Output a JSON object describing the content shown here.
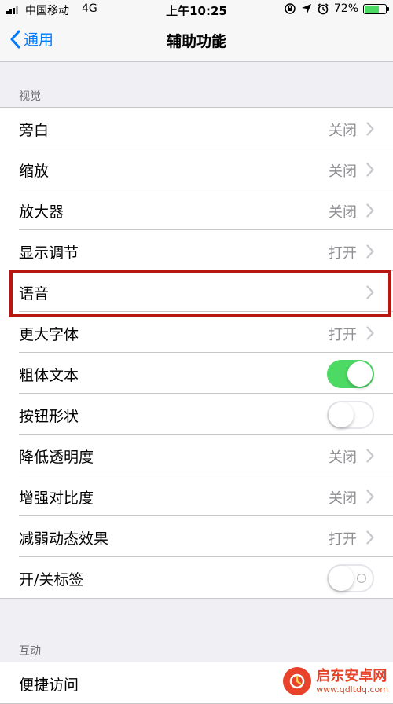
{
  "status_bar": {
    "carrier": "中国移动",
    "network": "4G",
    "time": "上午10:25",
    "battery": "72%",
    "battery_level": 0.72
  },
  "nav": {
    "back_label": "通用",
    "title": "辅助功能"
  },
  "sections": {
    "vision_header": "视觉",
    "interaction_header": "互动"
  },
  "vision_items": [
    {
      "label": "旁白",
      "value": "关闭",
      "control": "chevron"
    },
    {
      "label": "缩放",
      "value": "关闭",
      "control": "chevron"
    },
    {
      "label": "放大器",
      "value": "关闭",
      "control": "chevron"
    },
    {
      "label": "显示调节",
      "value": "打开",
      "control": "chevron"
    },
    {
      "label": "语音",
      "value": "",
      "control": "chevron"
    },
    {
      "label": "更大字体",
      "value": "打开",
      "control": "chevron"
    },
    {
      "label": "粗体文本",
      "control": "toggle",
      "on": true
    },
    {
      "label": "按钮形状",
      "control": "toggle",
      "on": false
    },
    {
      "label": "降低透明度",
      "value": "关闭",
      "control": "chevron"
    },
    {
      "label": "增强对比度",
      "value": "关闭",
      "control": "chevron"
    },
    {
      "label": "减弱动态效果",
      "value": "打开",
      "control": "chevron"
    },
    {
      "label": "开/关标签",
      "control": "toggle",
      "on": false
    }
  ],
  "interaction_items": [
    {
      "label": "便捷访问"
    }
  ],
  "watermark": {
    "name": "启东安卓网",
    "url": "www.qdltdq.com"
  },
  "colors": {
    "accent": "#007aff",
    "toggle_on": "#4cd964",
    "highlight": "#b8170f"
  }
}
